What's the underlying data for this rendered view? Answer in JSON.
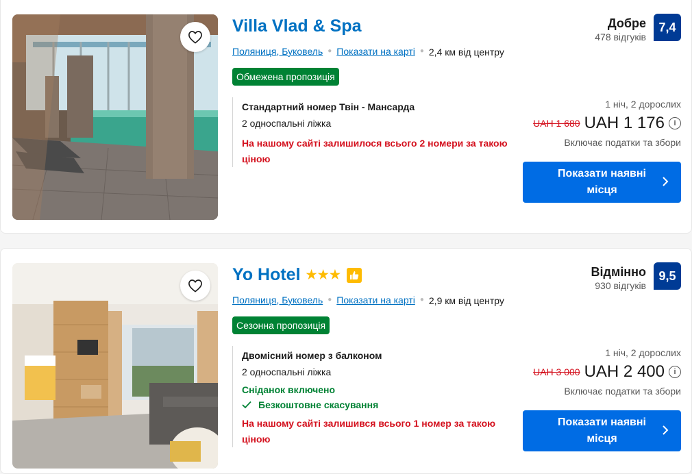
{
  "hotels": [
    {
      "name": "Villa Vlad & Spa",
      "stars": "",
      "location_link": "Поляниця, Буковель",
      "map_link": "Показати на карті",
      "distance": "2,4 км від центру",
      "badge": "Обмежена пропозиція",
      "room_name": "Стандартний номер Твін - Мансарда",
      "beds": "2 односпальні ліжка",
      "breakfast": "",
      "cancellation": "",
      "scarcity": "На нашому сайті залишилося всього 2 номери за такою ціною",
      "score_label": "Добре",
      "reviews": "478 відгуків",
      "score": "7,4",
      "nights": "1 ніч, 2 дорослих",
      "old_price": "UAH 1 680",
      "price": "UAH 1 176",
      "taxes": "Включає податки та збори",
      "cta": "Показати наявні місця"
    },
    {
      "name": "Yo Hotel",
      "stars": "★★★",
      "location_link": "Поляниця, Буковель",
      "map_link": "Показати на карті",
      "distance": "2,9 км від центру",
      "badge": "Сезонна пропозиція",
      "room_name": "Двомісний номер з балконом",
      "beds": "2 односпальні ліжка",
      "breakfast": "Сніданок включено",
      "cancellation": "Безкоштовне скасування",
      "scarcity": "На нашому сайті залишився всього 1 номер за такою ціною",
      "score_label": "Відмінно",
      "reviews": "930 відгуків",
      "score": "9,5",
      "nights": "1 ніч, 2 дорослих",
      "old_price": "UAH 3 000",
      "price": "UAH 2 400",
      "taxes": "Включає податки та збори",
      "cta": "Показати наявні місця"
    }
  ],
  "colors": {
    "link": "#0071c2",
    "badge_green": "#008234",
    "score_blue": "#003b95",
    "cta_blue": "#006ce4",
    "alert_red": "#d4111e"
  }
}
